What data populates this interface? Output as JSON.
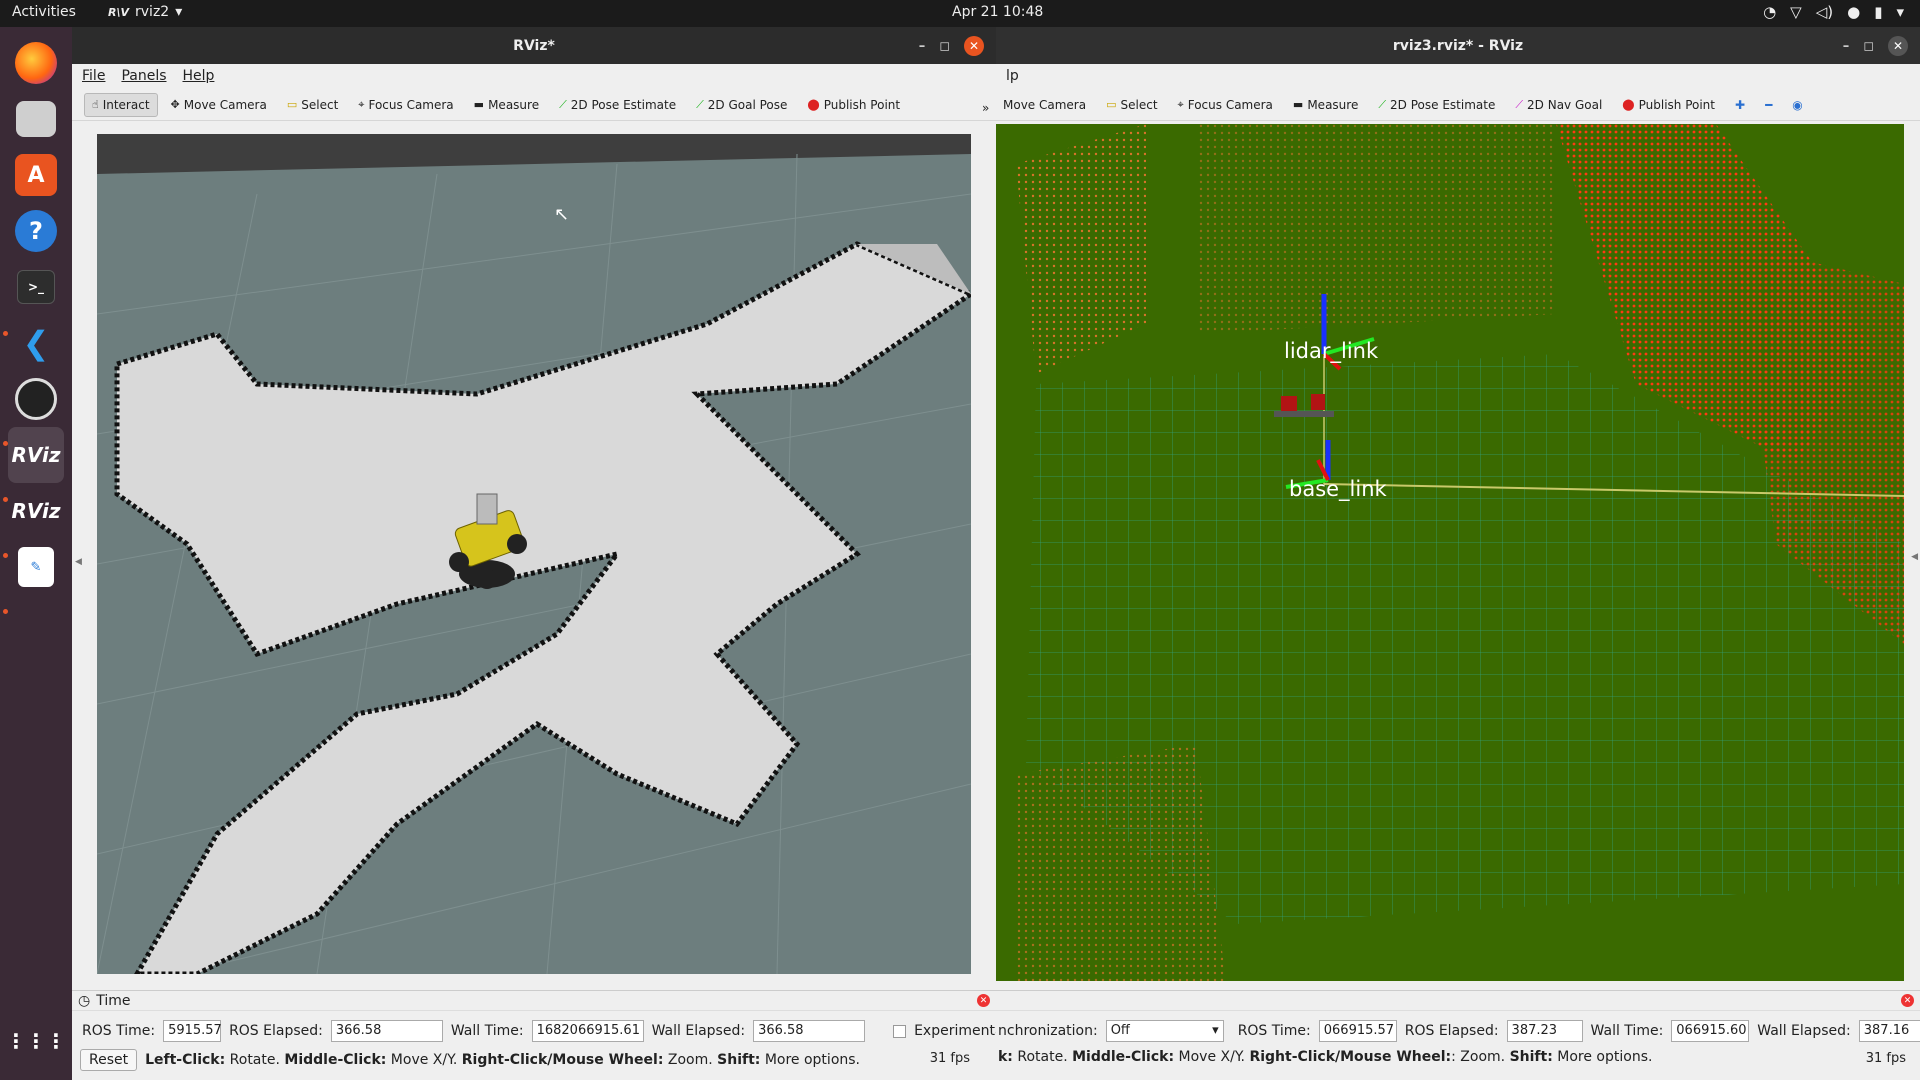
{
  "topbar": {
    "activities": "Activities",
    "app_name": "rviz2",
    "clock": "Apr 21  10:48"
  },
  "dock": {
    "apps": [
      "firefox-icon",
      "files-icon",
      "app-center-icon",
      "help-icon",
      "terminal-icon",
      "vscode-icon",
      "obs-icon",
      "rviz-icon",
      "rviz-icon",
      "text-editor-icon",
      "show-apps-icon"
    ]
  },
  "left_window": {
    "title": "RViz*",
    "menu": [
      "File",
      "Panels",
      "Help"
    ],
    "tools": [
      "Interact",
      "Move Camera",
      "Select",
      "Focus Camera",
      "Measure",
      "2D Pose Estimate",
      "2D Goal Pose",
      "Publish Point"
    ],
    "time_panel": {
      "title": "Time",
      "ros_time_label": "ROS Time:",
      "ros_time": "5915.57",
      "ros_elapsed_label": "ROS Elapsed:",
      "ros_elapsed": "366.58",
      "wall_time_label": "Wall Time:",
      "wall_time": "1682066915.61",
      "wall_elapsed_label": "Wall Elapsed:",
      "wall_elapsed": "366.58",
      "experimental_label": "Experimental",
      "reset_label": "Reset",
      "hint_left_click": "Left-Click:",
      "hint_left_text": " Rotate. ",
      "hint_middle_click": "Middle-Click:",
      "hint_middle_text": " Move X/Y. ",
      "hint_right_click": "Right-Click/Mouse Wheel:",
      "hint_right_text": " Zoom. ",
      "hint_shift": "Shift:",
      "hint_shift_text": " More options.",
      "fps": "31 fps"
    }
  },
  "right_window": {
    "title": "rviz3.rviz* - RViz",
    "menu_partial": "lp",
    "tools": [
      "Move Camera",
      "Select",
      "Focus Camera",
      "Measure",
      "2D Pose Estimate",
      "2D Nav Goal",
      "Publish Point"
    ],
    "frame_labels": [
      "lidar_link",
      "base_link"
    ],
    "time_panel": {
      "sync_label": "nchronization:",
      "sync_value": "Off",
      "ros_time_label": "ROS Time:",
      "ros_time": "066915.57",
      "ros_elapsed_label": "ROS Elapsed:",
      "ros_elapsed": "387.23",
      "wall_time_label": "Wall Time:",
      "wall_time": "066915.60",
      "wall_elapsed_label": "Wall Elapsed:",
      "wall_elapsed": "387.16",
      "hint_left_tail": "k:",
      "hint_left_text": " Rotate. ",
      "hint_middle_click": "Middle-Click:",
      "hint_middle_text": " Move X/Y. ",
      "hint_right_click": "Right-Click/Mouse Wheel:",
      "hint_right_text": ": Zoom. ",
      "hint_shift": "Shift:",
      "hint_shift_text": " More options.",
      "fps": "31 fps"
    }
  }
}
